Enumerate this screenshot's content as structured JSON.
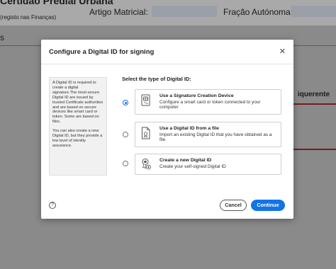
{
  "background": {
    "partial_title": "Certidão Predial Urbana",
    "partial_subtitle": "(registo nas Finanças)",
    "field_1_label": "Artigo Matricial:",
    "field_2_label": "Fração Autónoma:",
    "partial_left": "s",
    "partial_right": "iquerente"
  },
  "dialog": {
    "title": "Configure a Digital ID for signing",
    "close_symbol": "✕",
    "info_paragraph_1": "A Digital ID is required to create a digital signature.The most secure Digital ID are issued by trusted Certificate authorities and are based on secure devices like smart card or token. Some are based on files.",
    "info_paragraph_2": "You can also create a new Digital ID, but they provide a low level of identity assurance.",
    "select_label": "Select the type of Digital ID:",
    "options": [
      {
        "title": "Use a Signature Creation Device",
        "description": "Configure a smart card or token connected to your computer",
        "icon": "smart-card-icon",
        "selected": true
      },
      {
        "title": "Use a Digital ID from a file",
        "description": "Import an existing Digital ID that you have obtained as a file",
        "icon": "certificate-file-icon",
        "selected": false
      },
      {
        "title": "Create a new Digital ID",
        "description": "Create your self-signed Digital ID",
        "icon": "new-id-badge-icon",
        "selected": false
      }
    ],
    "help_symbol": "?",
    "cancel_label": "Cancel",
    "continue_label": "Continue"
  },
  "colors": {
    "accent": "#1473e6",
    "overlay": "#7a7a7a"
  }
}
